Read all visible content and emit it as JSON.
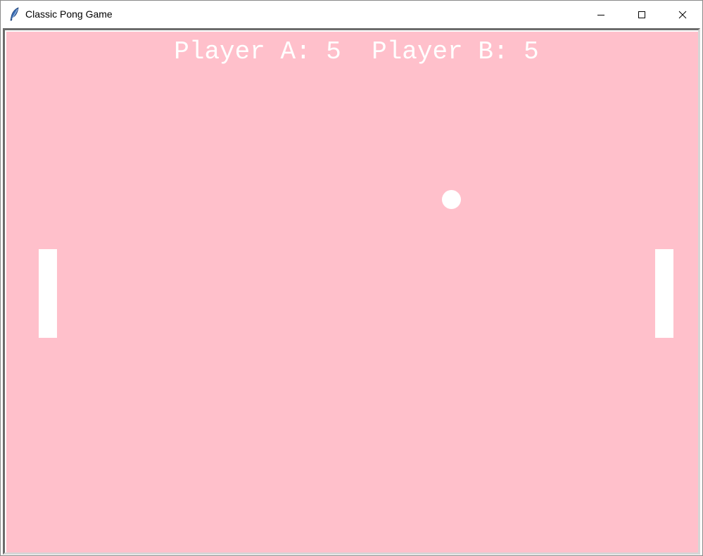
{
  "window": {
    "title": "Classic Pong Game",
    "icon": "feather-icon",
    "controls": {
      "minimize": "minimize-icon",
      "maximize": "maximize-icon",
      "close": "close-icon"
    }
  },
  "game": {
    "background_color": "#ffc0cb",
    "foreground_color": "#ffffff",
    "score_text": "Player A: 5  Player B: 5",
    "player_a_score": 5,
    "player_b_score": 5
  }
}
